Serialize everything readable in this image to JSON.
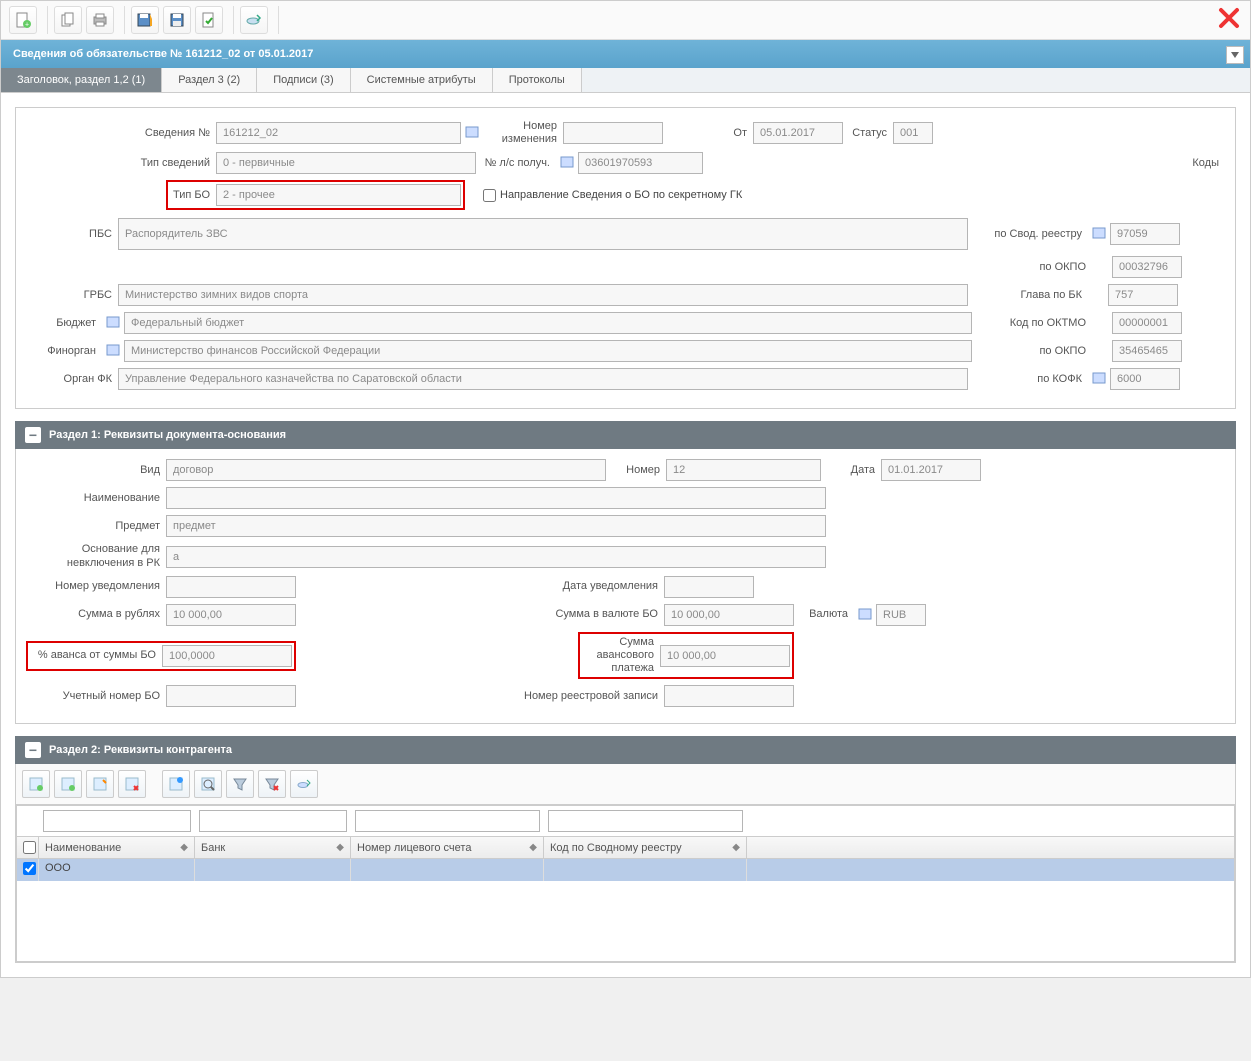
{
  "titlebar": "Сведения об обязательстве № 161212_02 от 05.01.2017",
  "tabs": [
    "Заголовок, раздел 1,2 (1)",
    "Раздел 3 (2)",
    "Подписи (3)",
    "Системные атрибуты",
    "Протоколы"
  ],
  "header": {
    "l_svedeniya_no": "Сведения №",
    "v_svedeniya_no": "161212_02",
    "l_nomer_izm": "Номер изменения",
    "v_nomer_izm": "",
    "l_ot": "От",
    "v_ot": "05.01.2017",
    "l_status": "Статус",
    "v_status": "001",
    "l_tip_sved": "Тип сведений",
    "v_tip_sved": "0 - первичные",
    "l_ls_poluch": "№ л/с получ.",
    "v_ls_poluch": "03601970593",
    "l_kody": "Коды",
    "l_tip_bo": "Тип БО",
    "v_tip_bo": "2 - прочее",
    "l_napravlenie": "Направление Сведения о БО по секретному ГК",
    "l_pbs": "ПБС",
    "v_pbs": "Распорядитель ЗВС",
    "l_svod_reestr": "по Свод. реестру",
    "v_svod_reestr": "97059",
    "l_okpo1": "по ОКПО",
    "v_okpo1": "00032796",
    "l_grbs": "ГРБС",
    "v_grbs": "Министерство зимних видов спорта",
    "l_glava_bk": "Глава по БК",
    "v_glava_bk": "757",
    "l_budget": "Бюджет",
    "v_budget": "Федеральный бюджет",
    "l_oktmo": "Код по ОКТМО",
    "v_oktmo": "00000001",
    "l_finorgan": "Финорган",
    "v_finorgan": "Министерство финансов Российской Федерации",
    "l_okpo2": "по ОКПО",
    "v_okpo2": "35465465",
    "l_organ_fk": "Орган ФК",
    "v_organ_fk": "Управление Федерального казначейства по Саратовской области",
    "l_kofk": "по КОФК",
    "v_kofk": "6000"
  },
  "section1": {
    "title": "Раздел 1: Реквизиты документа-основания",
    "l_vid": "Вид",
    "v_vid": "договор",
    "l_nomer": "Номер",
    "v_nomer": "12",
    "l_data": "Дата",
    "v_data": "01.01.2017",
    "l_naim": "Наименование",
    "v_naim": "",
    "l_predmet": "Предмет",
    "v_predmet": "предмет",
    "l_osnov": "Основание для невключения в РК",
    "v_osnov": "а",
    "l_nomer_uved": "Номер уведомления",
    "v_nomer_uved": "",
    "l_data_uved": "Дата уведомления",
    "v_data_uved": "",
    "l_summa_rub": "Сумма в рублях",
    "v_summa_rub": "10 000,00",
    "l_summa_val": "Сумма в валюте БО",
    "v_summa_val": "10 000,00",
    "l_valuta": "Валюта",
    "v_valuta": "RUB",
    "l_pct_avans": "% аванса от суммы БО",
    "v_pct_avans": "100,0000",
    "l_summa_avans": "Сумма авансового платежа",
    "v_summa_avans": "10 000,00",
    "l_uchet_no": "Учетный номер БО",
    "v_uchet_no": "",
    "l_nomer_reestr": "Номер реестровой записи",
    "v_nomer_reestr": ""
  },
  "section2": {
    "title": "Раздел 2: Реквизиты контрагента",
    "columns": [
      "Наименование",
      "Банк",
      "Номер лицевого счета",
      "Код по Сводному реестру"
    ],
    "rows": [
      {
        "checked": true,
        "name": "ООО",
        "bank": "",
        "ls": "",
        "kod": ""
      }
    ]
  }
}
